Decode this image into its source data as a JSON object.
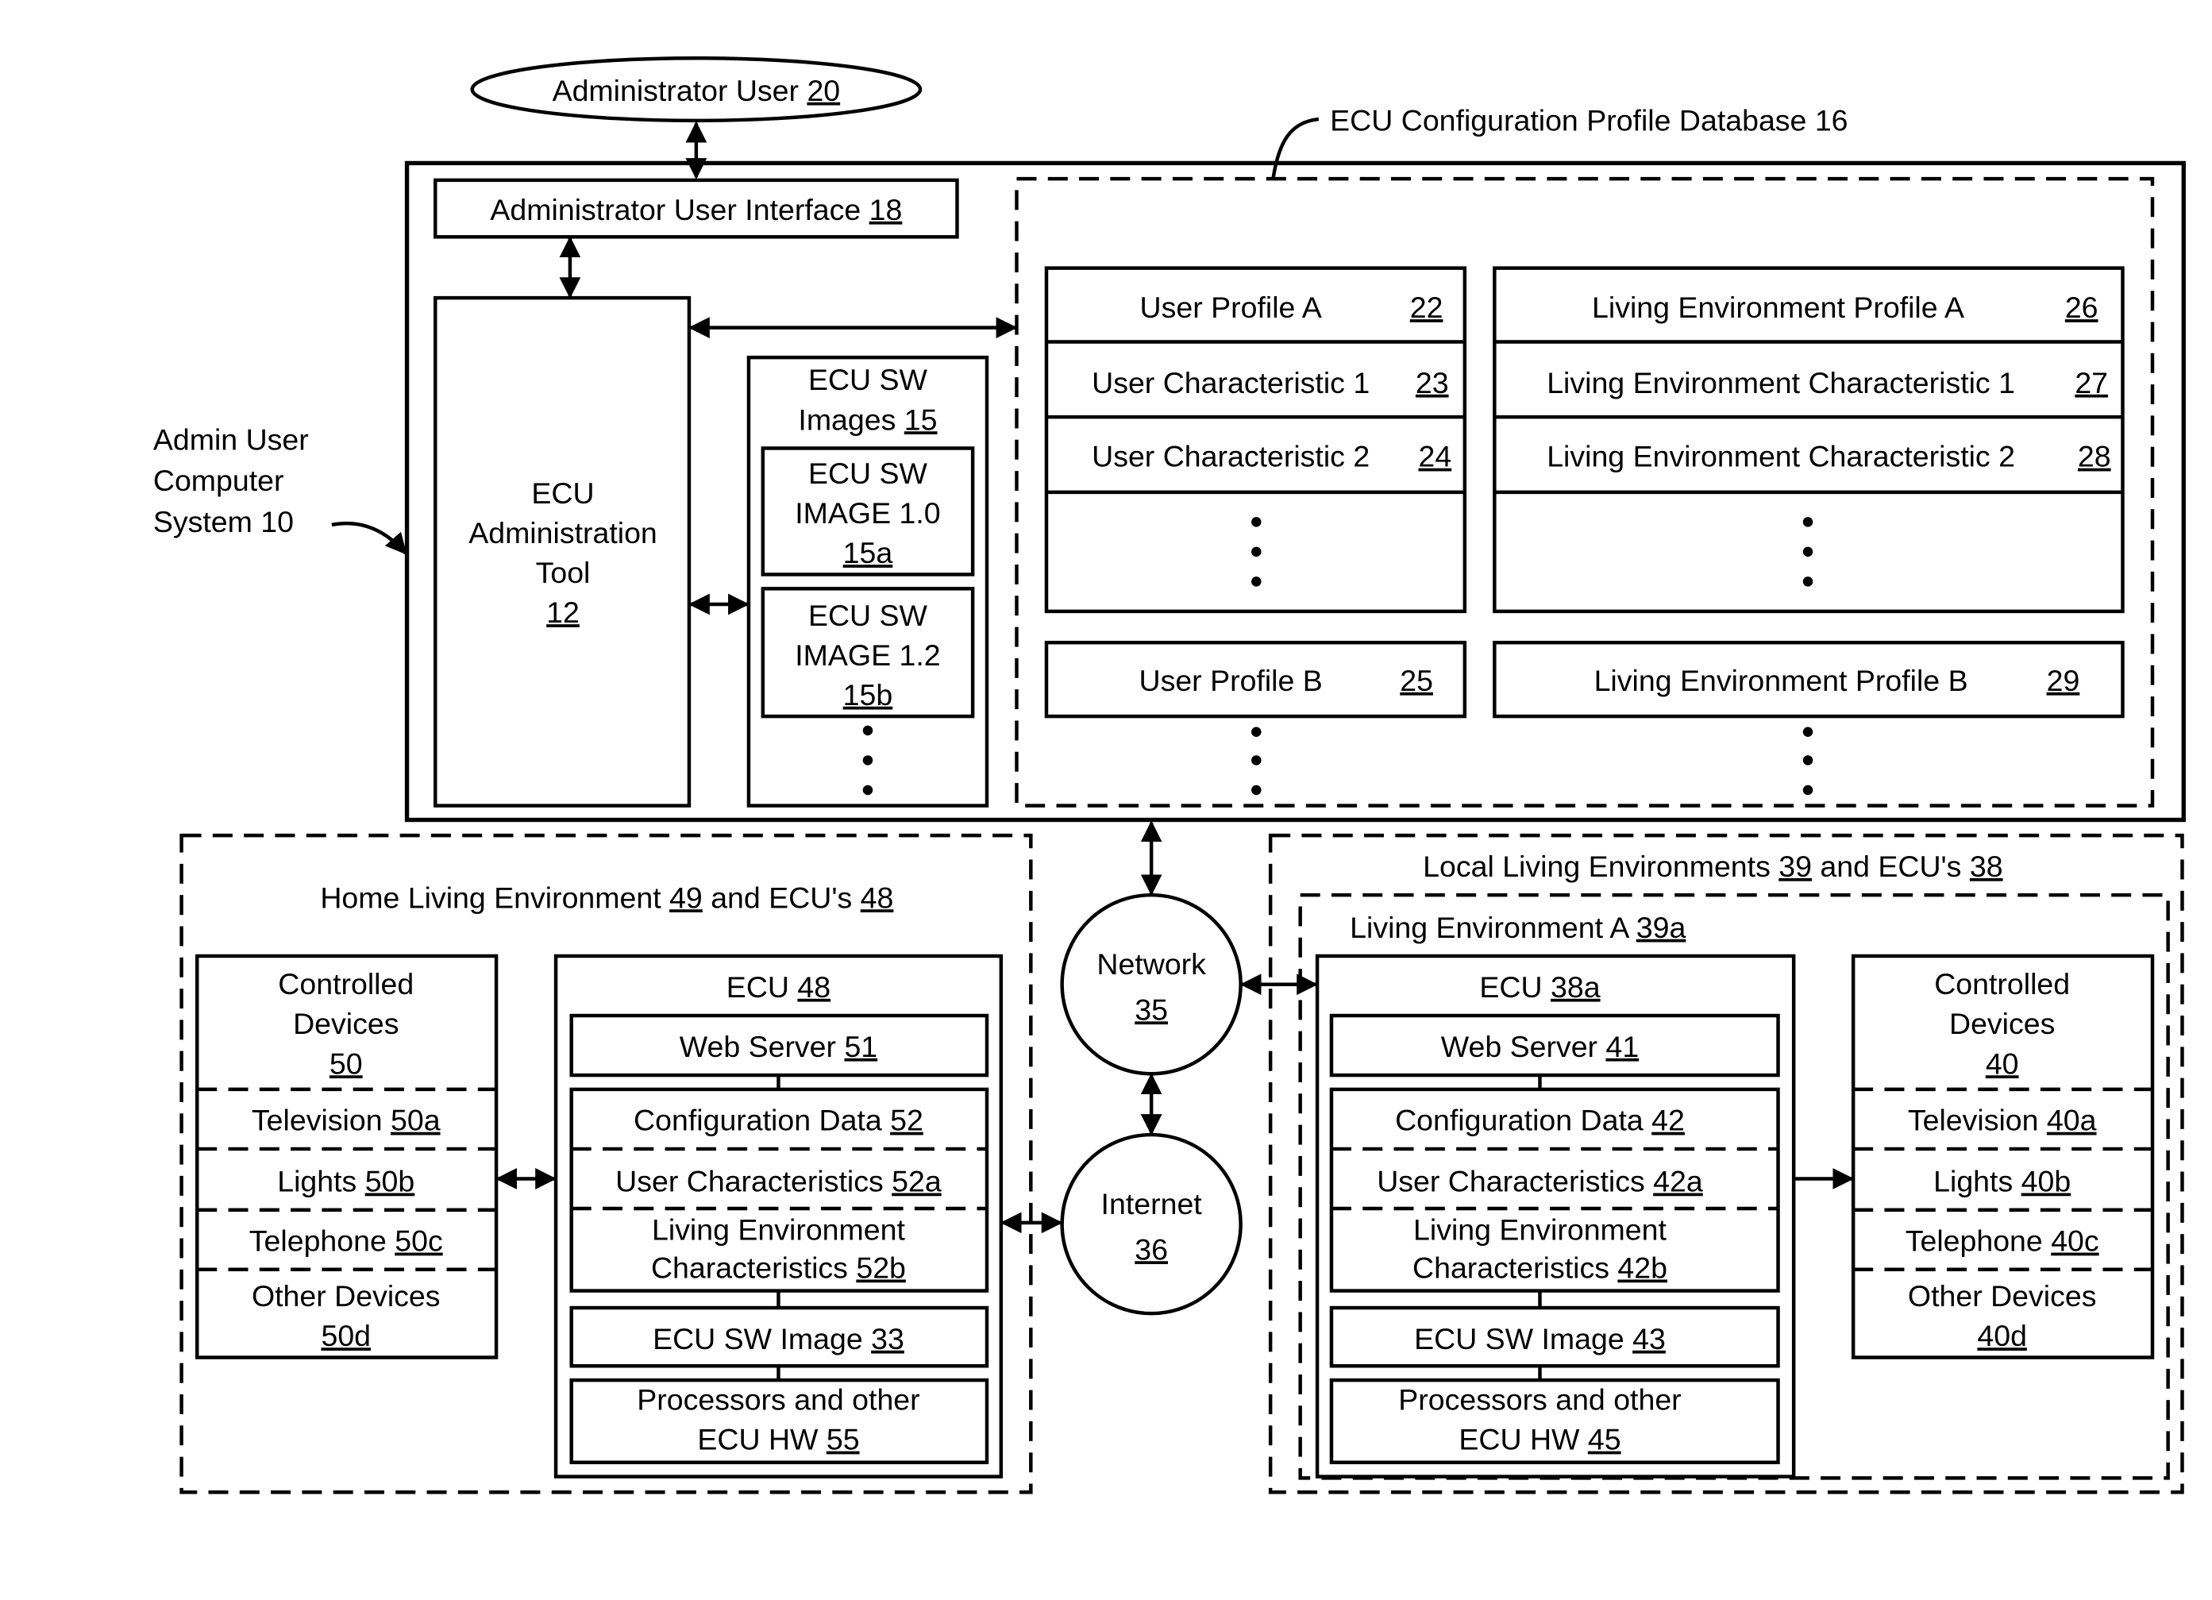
{
  "admin_user": {
    "label": "Administrator User ",
    "ref": "20"
  },
  "database_label": "ECU Configuration Profile Database 16",
  "admin_system_label": [
    "Admin User",
    "Computer",
    "System 10"
  ],
  "admin_ui": {
    "label": "Administrator User Interface ",
    "ref": "18"
  },
  "admin_tool": {
    "lines": [
      "ECU",
      "Administration",
      "Tool"
    ],
    "ref": "12"
  },
  "sw_images": {
    "title": [
      "ECU SW",
      "Images "
    ],
    "ref": "15",
    "items": [
      {
        "lines": [
          "ECU SW",
          "IMAGE 1.0"
        ],
        "ref": "15a"
      },
      {
        "lines": [
          "ECU SW",
          "IMAGE 1.2"
        ],
        "ref": "15b"
      }
    ]
  },
  "user_profile_a": {
    "rows": [
      {
        "label": "User Profile A",
        "ref": "22"
      },
      {
        "label": "User Characteristic 1",
        "ref": "23"
      },
      {
        "label": "User Characteristic 2",
        "ref": "24"
      }
    ]
  },
  "living_profile_a": {
    "rows": [
      {
        "label": "Living Environment Profile A",
        "ref": "26"
      },
      {
        "label": "Living Environment Characteristic 1",
        "ref": "27"
      },
      {
        "label": "Living Environment Characteristic 2",
        "ref": "28"
      }
    ]
  },
  "user_profile_b": {
    "label": "User Profile B",
    "ref": "25"
  },
  "living_profile_b": {
    "label": "Living Environment Profile B",
    "ref": "29"
  },
  "network": {
    "label": "Network",
    "ref": "35"
  },
  "internet": {
    "label": "Internet",
    "ref": "36"
  },
  "home": {
    "title": {
      "a": "Home Living Environment ",
      "ref1": "49",
      "b": " and ECU's ",
      "ref2": "48"
    },
    "devices": {
      "title": [
        "Controlled",
        "Devices"
      ],
      "ref": "50",
      "items": [
        {
          "label": "Television ",
          "ref": "50a"
        },
        {
          "label": "Lights ",
          "ref": "50b"
        },
        {
          "label": "Telephone ",
          "ref": "50c"
        },
        {
          "label": "Other Devices",
          "ref": "50d"
        }
      ]
    },
    "ecu": {
      "title": "ECU ",
      "ref": "48",
      "web_server": {
        "label": "Web Server ",
        "ref": "51"
      },
      "config": {
        "label": "Configuration Data ",
        "ref": "52"
      },
      "user_chars": {
        "label": "User Characteristics ",
        "ref": "52a"
      },
      "living_chars": {
        "line1": "Living Environment",
        "line2": "Characteristics ",
        "ref": "52b"
      },
      "sw_image": {
        "label": "ECU SW Image ",
        "ref": "33"
      },
      "hw": {
        "line1": "Processors and other",
        "line2": "ECU HW ",
        "ref": "55"
      }
    }
  },
  "local": {
    "title": {
      "a": "Local Living Environments ",
      "ref1": "39",
      "b": " and ECU's ",
      "ref2": "38"
    },
    "env_a": {
      "label": "Living Environment A ",
      "ref": "39a"
    },
    "ecu": {
      "title": "ECU ",
      "ref": "38a",
      "web_server": {
        "label": "Web Server ",
        "ref": "41"
      },
      "config": {
        "label": "Configuration Data ",
        "ref": "42"
      },
      "user_chars": {
        "label": "User Characteristics ",
        "ref": "42a"
      },
      "living_chars": {
        "line1": "Living Environment",
        "line2": "Characteristics ",
        "ref": "42b"
      },
      "sw_image": {
        "label": "ECU SW Image ",
        "ref": "43"
      },
      "hw": {
        "line1": "Processors and other",
        "line2": "ECU HW ",
        "ref": "45"
      }
    },
    "devices": {
      "title": [
        "Controlled",
        "Devices"
      ],
      "ref": "40",
      "items": [
        {
          "label": "Television ",
          "ref": "40a"
        },
        {
          "label": "Lights ",
          "ref": "40b"
        },
        {
          "label": "Telephone ",
          "ref": "40c"
        },
        {
          "label": "Other Devices",
          "ref": "40d"
        }
      ]
    }
  }
}
